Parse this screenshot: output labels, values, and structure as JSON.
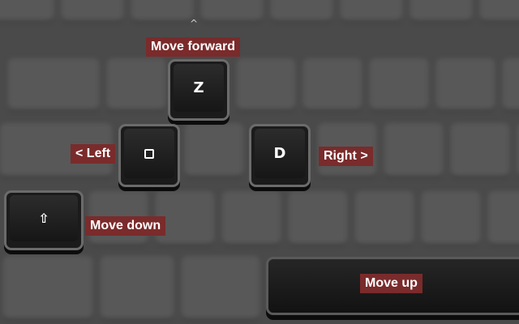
{
  "keys": {
    "forward": "Z",
    "left": "Q",
    "right": "D",
    "down": "⇧"
  },
  "labels": {
    "move_forward": "Move forward",
    "left": "<  Left",
    "right": "Right  >",
    "move_down": "Move down",
    "move_up": "Move up"
  },
  "hint_caret": "^",
  "colors": {
    "label_bg": "#7a2b2b",
    "key_bg": "#1b1b1b",
    "background": "#4a4a4a"
  }
}
